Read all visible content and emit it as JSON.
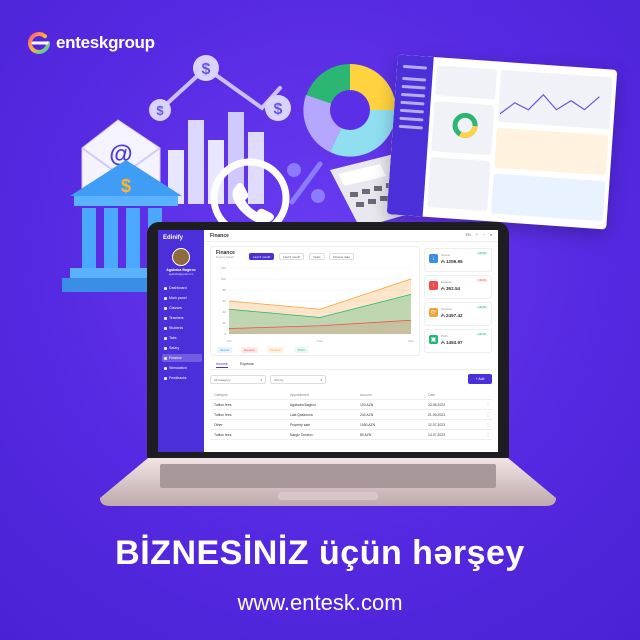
{
  "brand": {
    "name": "enteskgroup"
  },
  "headline": "BİZNESİNİZ üçün hərşey",
  "url": "www.entesk.com",
  "colors": {
    "background": "#5b2ee8",
    "accent": "#4b2fd9",
    "green": "#22b573",
    "red": "#f04b4b",
    "orange": "#f5a23a"
  },
  "app": {
    "logo": "Edinify",
    "user": {
      "name": "Agababa Bagirov",
      "email": "agababa@gmail.com"
    },
    "nav": [
      "Dashboard",
      "Main panel",
      "Classes",
      "Teachers",
      "Students",
      "Tabs",
      "Salary",
      "Finance",
      "Stimulation",
      "Feedbacks"
    ],
    "page_title": "Finance",
    "topbar": {
      "lang": "EN",
      "icons": [
        "globe-icon",
        "help-icon",
        "bell-icon",
        "user-icon"
      ]
    },
    "finance": {
      "title": "Finance",
      "subtitle": "Finance Details",
      "filters": [
        "Last 3 month",
        "Last 6 month",
        "Years",
        "Choose date"
      ],
      "legend": [
        "Income",
        "Expense",
        "Turnover",
        "Profit"
      ]
    },
    "chart_data": {
      "type": "area",
      "x": [
        "Jan",
        "Feb",
        "Mar"
      ],
      "series": [
        {
          "name": "Turnover",
          "values": [
            60,
            45,
            100
          ]
        },
        {
          "name": "Income",
          "values": [
            45,
            30,
            72
          ]
        },
        {
          "name": "Expense",
          "values": [
            10,
            15,
            25
          ]
        }
      ],
      "ylim": [
        0,
        120
      ],
      "yticks": [
        "120",
        "100",
        "80",
        "60",
        "40",
        "20",
        "0"
      ]
    },
    "stats": [
      {
        "label": "Income",
        "value": "₼ 1259.95",
        "badge": "+30.3%"
      },
      {
        "label": "Expense",
        "value": "₼ 362.54",
        "badge": "-30.3%"
      },
      {
        "label": "Turnover",
        "value": "₼ 2497.42",
        "badge": "+30.3%"
      },
      {
        "label": "Profit",
        "value": "₼ 1453.97",
        "badge": "+30.3%"
      }
    ],
    "tabs": [
      "Income",
      "Expense"
    ],
    "filters_row": {
      "category": "All Category",
      "sort": "Sort by",
      "add": "+ Add"
    },
    "table": {
      "headers": [
        "Category",
        "Appointment",
        "Amount",
        "Date"
      ],
      "rows": [
        [
          "Tuition fees",
          "Agababa Bagirov",
          "100 AZN",
          "23.08.2023"
        ],
        [
          "Tuition fees",
          "Lala Qasimova",
          "240 AZN",
          "21.09.2023"
        ],
        [
          "Other",
          "Property sale",
          "1050 AZN",
          "12.07.2023"
        ],
        [
          "Tuition fees",
          "Nargiz Omarov",
          "80 AZN",
          "14.07.2023"
        ]
      ]
    }
  }
}
